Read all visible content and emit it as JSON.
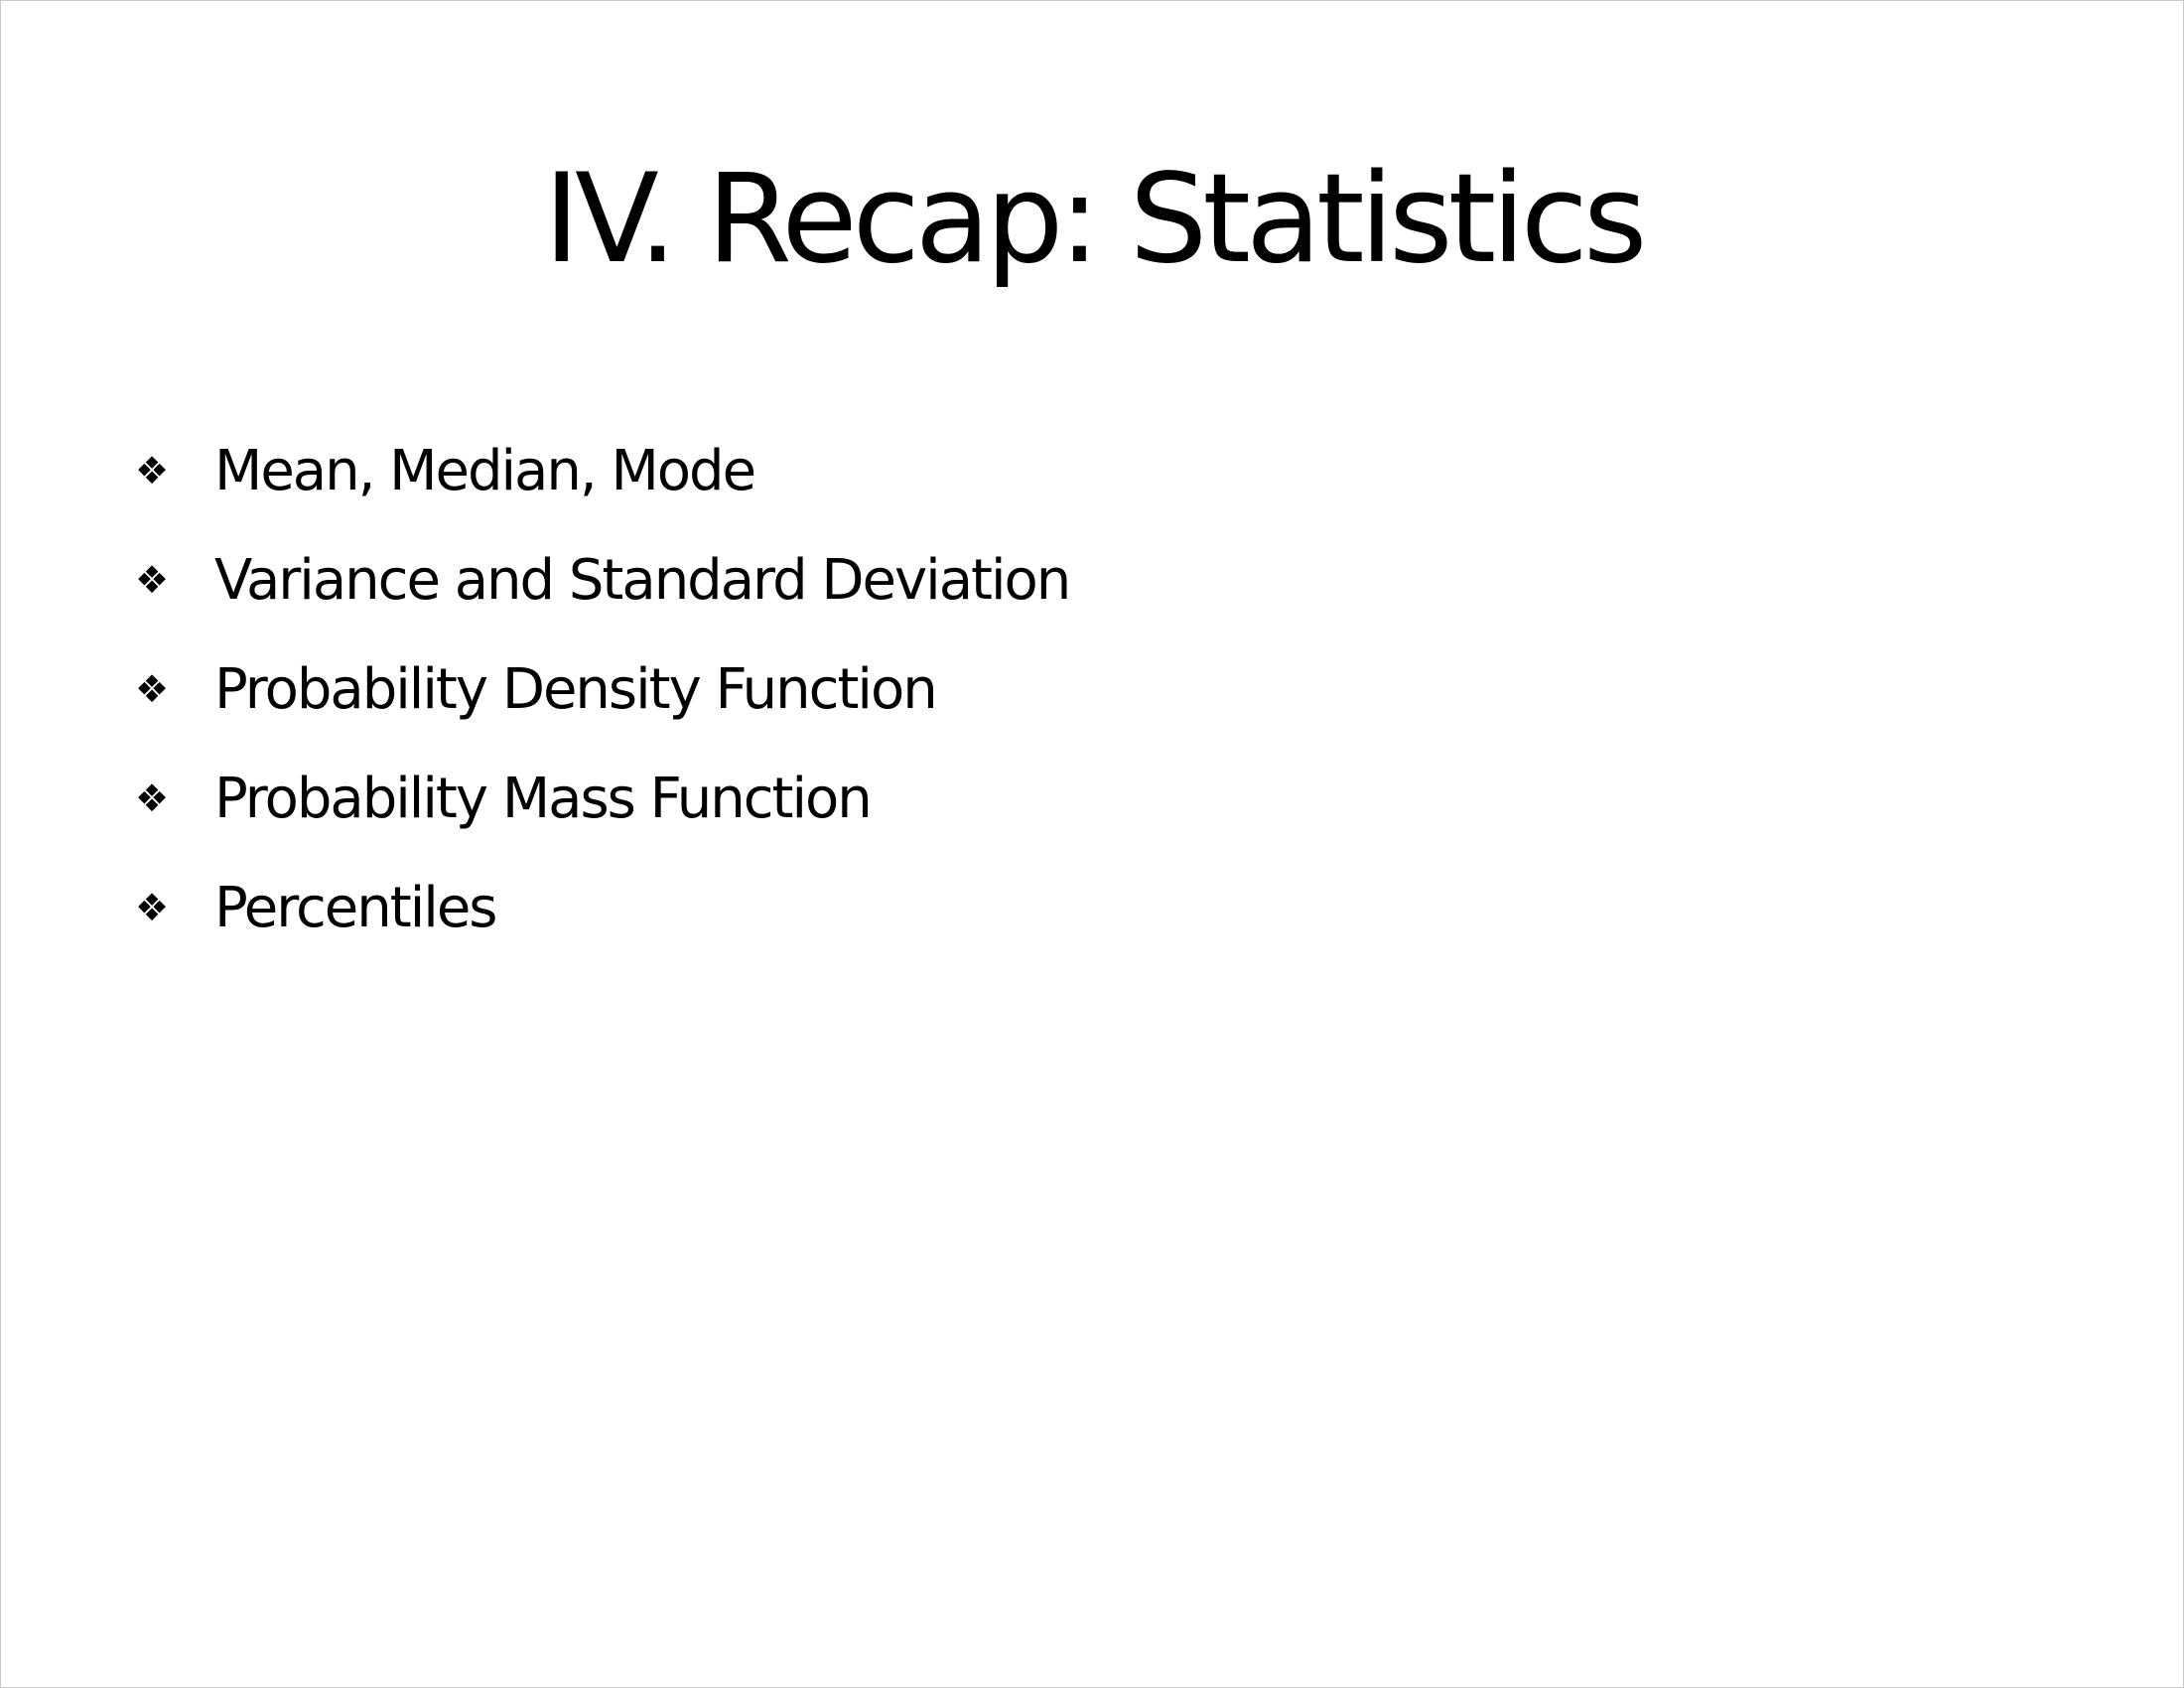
{
  "slide": {
    "title": "IV. Recap: Statistics",
    "bullet_icon": "four-diamond-bullet-icon",
    "bullets": [
      "Mean, Median, Mode",
      "Variance and Standard Deviation",
      "Probability Density Function",
      "Probability Mass Function",
      "Percentiles"
    ]
  }
}
